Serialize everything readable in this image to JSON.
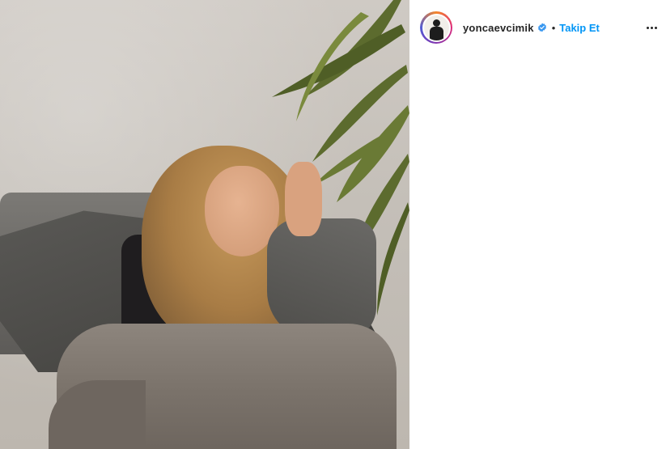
{
  "post": {
    "username": "yoncaevcimik",
    "verified_badge": "verified-badge-icon",
    "separator": "•",
    "follow_label": "Takip Et",
    "more_icon": "more-options-icon",
    "colors": {
      "follow_blue": "#0095f6",
      "text": "#262626",
      "verified_blue": "#3897f0"
    }
  }
}
